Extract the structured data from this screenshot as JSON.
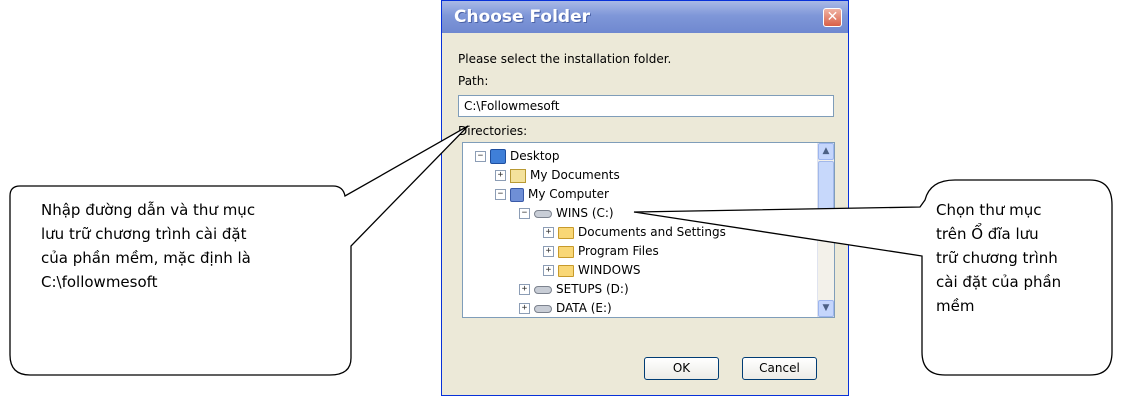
{
  "dialog": {
    "title": "Choose Folder",
    "close_glyph": "✕",
    "instruction": "Please select the installation folder.",
    "path_label": "Path:",
    "path_value": "C:\\Followmesoft",
    "directories_label": "Directories:",
    "tree": [
      {
        "label": "Desktop",
        "icon": "desktop-icon",
        "expander": "−"
      },
      {
        "label": "My Documents",
        "icon": "my-documents-icon",
        "expander": "+"
      },
      {
        "label": "My Computer",
        "icon": "my-computer-icon",
        "expander": "−"
      },
      {
        "label": "WINS (C:)",
        "icon": "drive-icon",
        "expander": "−"
      },
      {
        "label": "Documents and Settings",
        "icon": "folder-icon",
        "expander": "+"
      },
      {
        "label": "Program Files",
        "icon": "folder-icon",
        "expander": "+"
      },
      {
        "label": "WINDOWS",
        "icon": "folder-icon",
        "expander": "+"
      },
      {
        "label": "SETUPS (D:)",
        "icon": "drive-icon",
        "expander": "+"
      },
      {
        "label": "DATA (E:)",
        "icon": "drive-icon",
        "expander": "+"
      }
    ],
    "ok_label": "OK",
    "cancel_label": "Cancel",
    "colors": {
      "titlebar": "#7f97d8",
      "face": "#ece9d8",
      "border": "#0831d9"
    }
  },
  "callouts": {
    "left": {
      "lines": [
        "Nhập đường dẫn và thư mục",
        "lưu trữ chương trình cài đặt",
        "của phần mềm, mặc định là",
        "C:\\followmesoft"
      ]
    },
    "right": {
      "lines": [
        "Chọn thư mục",
        "trên Ổ đĩa lưu",
        "trữ chương trình",
        "cài đặt của phần",
        "mềm"
      ]
    }
  }
}
